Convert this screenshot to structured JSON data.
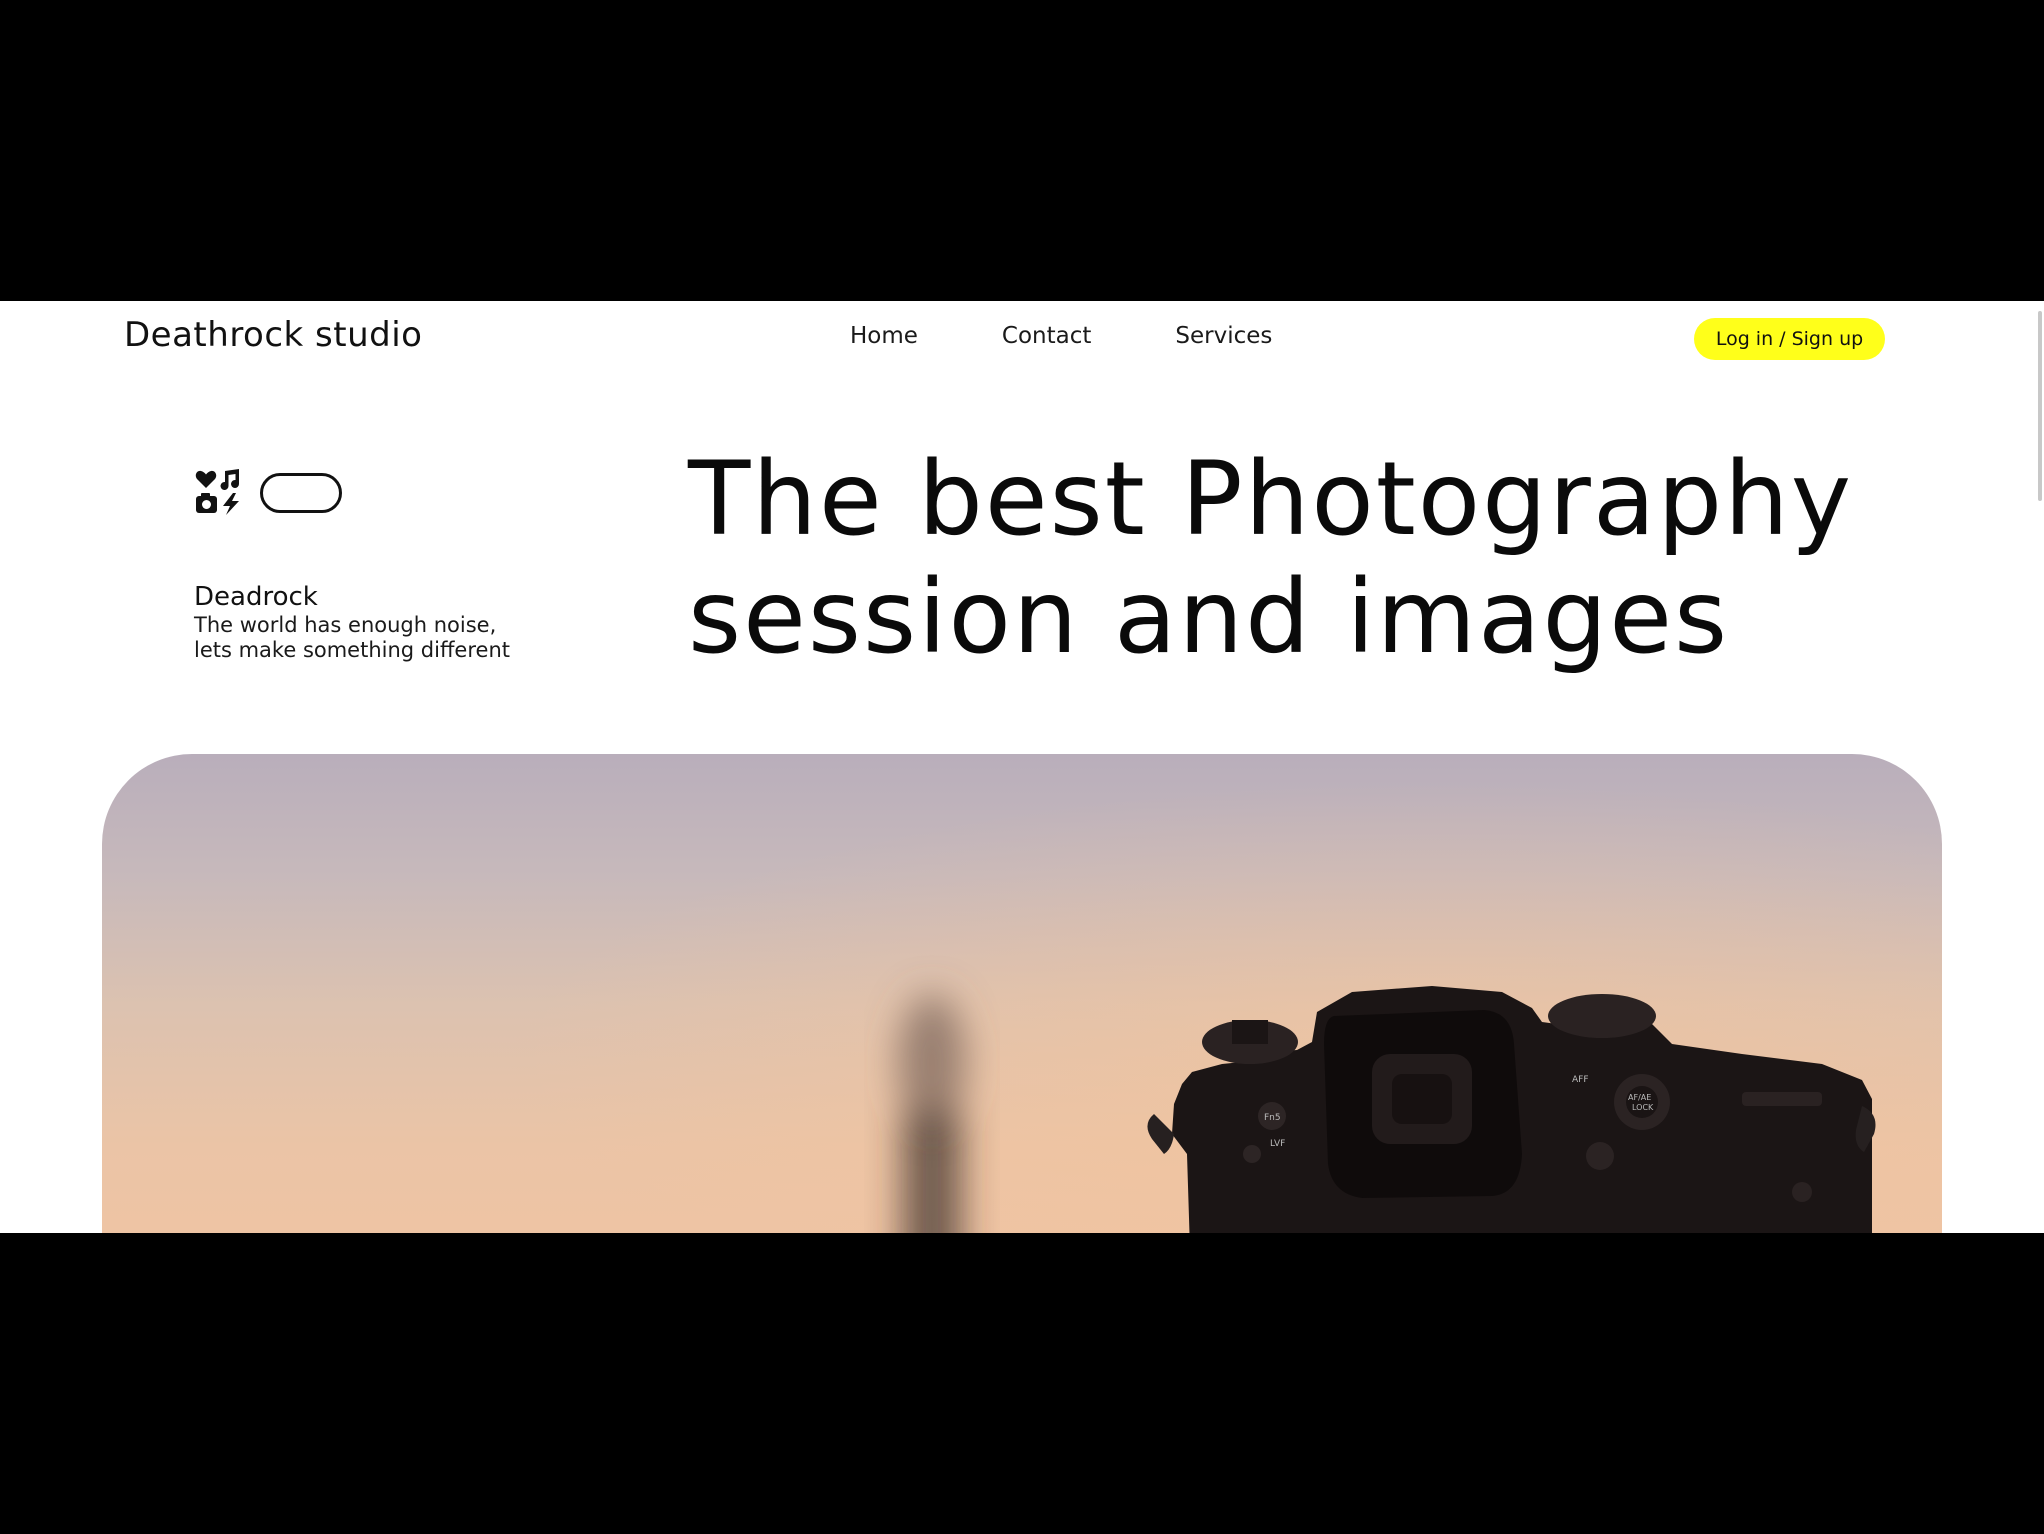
{
  "header": {
    "brand": "Deathrock studio",
    "nav": [
      "Home",
      "Contact",
      "Services"
    ],
    "login_label": "Log in / Sign up"
  },
  "intro": {
    "icon_cluster": [
      "heart-icon",
      "music-note-icon",
      "camera-icon",
      "lightning-icon"
    ],
    "title": "Deadrock",
    "description_line1": "The world has enough noise,",
    "description_line2": "lets make something different"
  },
  "hero": {
    "title_line1": "The best Photography",
    "title_line2": "session and images",
    "image": "camera-at-sunset-photo"
  },
  "colors": {
    "accent": "#ffff1a",
    "text": "#0a0a0a",
    "background": "#ffffff"
  }
}
